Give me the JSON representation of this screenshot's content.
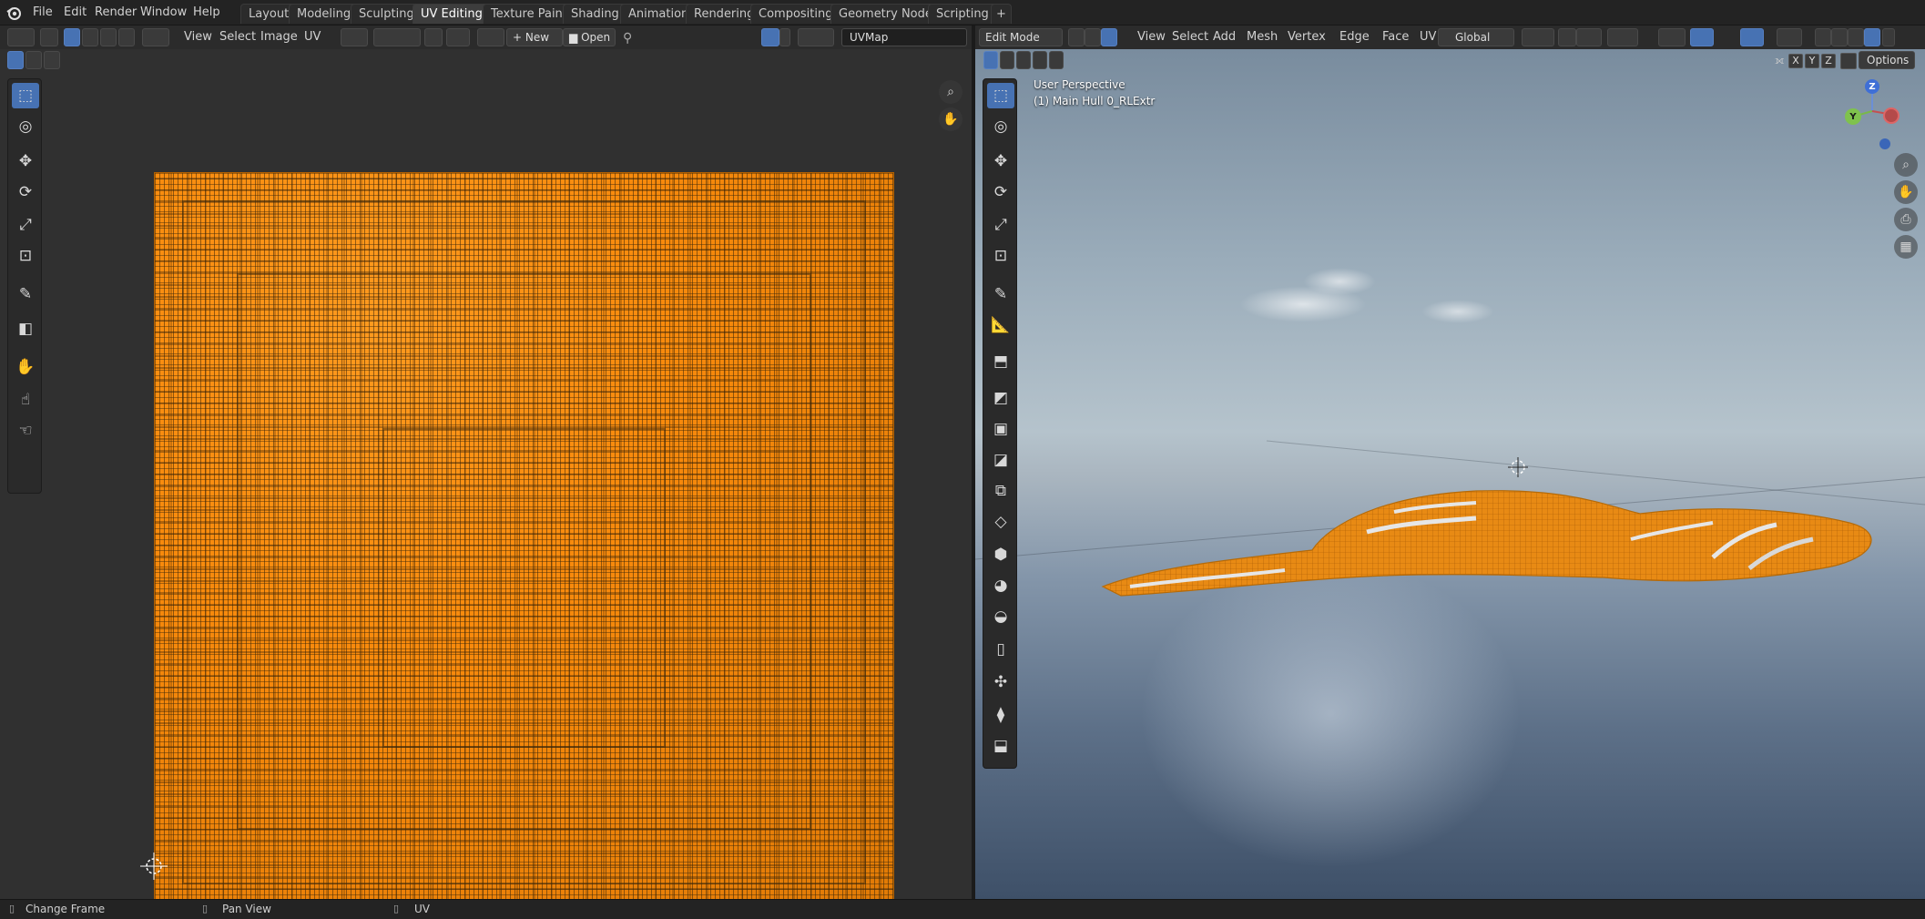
{
  "app_logo": "blender-logo",
  "menu": [
    "File",
    "Edit",
    "Render",
    "Window",
    "Help"
  ],
  "workspace_tabs": [
    "Layout",
    "Modeling",
    "Sculpting",
    "UV Editing",
    "Texture Paint",
    "Shading",
    "Animation",
    "Rendering",
    "Compositing",
    "Geometry Nodes",
    "Scripting"
  ],
  "active_workspace": "UV Editing",
  "add_tab_label": "+",
  "uv_editor": {
    "menus": [
      "View",
      "Select",
      "Image",
      "UV"
    ],
    "new_label": "New",
    "open_label": "Open",
    "uvmap_name": "UVMap"
  },
  "viewport": {
    "mode": "Edit Mode",
    "menus": [
      "View",
      "Select",
      "Add",
      "Mesh",
      "Vertex",
      "Edge",
      "Face",
      "UV"
    ],
    "transform_orientation": "Global",
    "options_label": "Options",
    "axis_buttons": [
      "X",
      "Y",
      "Z"
    ],
    "perspective_label": "User Perspective",
    "object_label": "(1) Main Hull 0_RLExtr",
    "gizmo_axes": [
      "Z",
      "Y"
    ]
  },
  "statusbar": {
    "items": [
      {
        "icon": "mouse-left-icon",
        "label": "Change Frame"
      },
      {
        "icon": "mouse-middle-icon",
        "label": "Pan View"
      },
      {
        "icon": "mouse-right-icon",
        "label": "UV"
      }
    ]
  },
  "colors": {
    "accent_blue": "#4772b3",
    "uv_orange": "#f58a10",
    "mesh_orange": "#e88a14"
  }
}
